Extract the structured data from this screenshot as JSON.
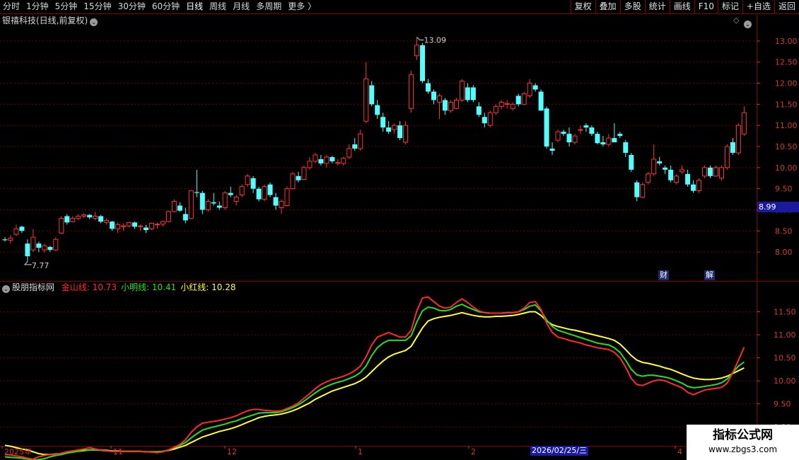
{
  "toolbar": {
    "period_tabs": [
      "分时",
      "1分钟",
      "5分钟",
      "15分钟",
      "30分钟",
      "60分钟",
      "日线",
      "周线",
      "月线",
      "多周期",
      "更多 〉"
    ],
    "active_period": "日线",
    "tools": [
      "复权",
      "叠加",
      "多股",
      "统计",
      "画线",
      "F10",
      "标记",
      "+自选",
      "返回"
    ]
  },
  "main_panel": {
    "title": "银禧科技(日线,前复权)",
    "high_annotation": "13.09",
    "low_annotation": "7.77",
    "current_price_tag": "8.99",
    "badges": [
      "财",
      "解"
    ],
    "y_ticks": [
      "13.00",
      "12.50",
      "12.00",
      "11.50",
      "11.00",
      "10.50",
      "10.00",
      "9.50",
      "9.00",
      "8.50",
      "8.00"
    ],
    "colors": {
      "up": "#ff3333",
      "down": "#54ffff"
    }
  },
  "indicator_panel": {
    "name": "股朋指标网",
    "lines": [
      {
        "label": "金山线:",
        "value": "10.73",
        "color": "#ff2a2a"
      },
      {
        "label": "小明线:",
        "value": "10.41",
        "color": "#22e022"
      },
      {
        "label": "小红线:",
        "value": "10.28",
        "color": "#ffff33"
      }
    ],
    "y_ticks": [
      "11.50",
      "11.00",
      "10.50",
      "10.00",
      "9.50",
      "9.00"
    ]
  },
  "x_axis": {
    "labels": [
      "2025年",
      "11",
      "12",
      "1",
      "2",
      "4"
    ],
    "cursor_date": "2026/02/25/三"
  },
  "watermark": {
    "line1": "指标公式网",
    "line2": "www.zbgs3.com"
  },
  "chart_data": {
    "type": "candlestick",
    "candles": [
      [
        8.3,
        8.35,
        8.25,
        8.28
      ],
      [
        8.28,
        8.4,
        8.2,
        8.33
      ],
      [
        8.42,
        8.65,
        8.38,
        8.55
      ],
      [
        8.6,
        8.62,
        8.45,
        8.5
      ],
      [
        8.2,
        8.3,
        7.77,
        7.9
      ],
      [
        8.05,
        8.55,
        8.0,
        8.35
      ],
      [
        8.2,
        8.25,
        8.0,
        8.1
      ],
      [
        8.05,
        8.2,
        7.98,
        8.15
      ],
      [
        8.12,
        8.15,
        8.0,
        8.05
      ],
      [
        8.05,
        8.35,
        8.02,
        8.3
      ],
      [
        8.45,
        8.85,
        8.42,
        8.8
      ],
      [
        8.85,
        8.9,
        8.65,
        8.7
      ],
      [
        8.72,
        8.85,
        8.7,
        8.8
      ],
      [
        8.8,
        8.9,
        8.75,
        8.85
      ],
      [
        8.85,
        8.92,
        8.8,
        8.88
      ],
      [
        8.88,
        8.9,
        8.78,
        8.82
      ],
      [
        8.8,
        8.95,
        8.75,
        8.85
      ],
      [
        8.85,
        8.88,
        8.68,
        8.72
      ],
      [
        8.7,
        8.8,
        8.65,
        8.75
      ],
      [
        8.72,
        8.74,
        8.5,
        8.55
      ],
      [
        8.55,
        8.7,
        8.45,
        8.65
      ],
      [
        8.6,
        8.68,
        8.5,
        8.62
      ],
      [
        8.62,
        8.72,
        8.58,
        8.7
      ],
      [
        8.7,
        8.72,
        8.55,
        8.6
      ],
      [
        8.6,
        8.65,
        8.5,
        8.62
      ],
      [
        8.58,
        8.64,
        8.45,
        8.52
      ],
      [
        8.55,
        8.7,
        8.52,
        8.68
      ],
      [
        8.65,
        8.7,
        8.55,
        8.66
      ],
      [
        8.66,
        8.75,
        8.6,
        8.72
      ],
      [
        8.72,
        8.98,
        8.7,
        8.96
      ],
      [
        8.96,
        9.25,
        8.94,
        9.2
      ],
      [
        9.1,
        9.18,
        8.95,
        8.98
      ],
      [
        8.9,
        9.05,
        8.68,
        8.75
      ],
      [
        8.8,
        9.45,
        8.78,
        9.45
      ],
      [
        9.42,
        9.95,
        9.3,
        9.4
      ],
      [
        9.4,
        9.45,
        8.9,
        9.0
      ],
      [
        9.0,
        9.25,
        8.95,
        9.2
      ],
      [
        9.18,
        9.4,
        9.1,
        9.15
      ],
      [
        9.1,
        9.2,
        9.0,
        9.05
      ],
      [
        9.05,
        9.45,
        9.0,
        9.4
      ],
      [
        9.4,
        9.55,
        9.3,
        9.35
      ],
      [
        9.2,
        9.35,
        9.1,
        9.3
      ],
      [
        9.35,
        9.6,
        9.3,
        9.55
      ],
      [
        9.6,
        9.85,
        9.55,
        9.8
      ],
      [
        9.75,
        9.8,
        9.4,
        9.5
      ],
      [
        9.5,
        9.55,
        9.2,
        9.25
      ],
      [
        9.25,
        9.6,
        9.2,
        9.55
      ],
      [
        9.6,
        9.65,
        9.3,
        9.35
      ],
      [
        9.3,
        9.4,
        9.0,
        9.1
      ],
      [
        9.05,
        9.25,
        8.9,
        9.2
      ],
      [
        9.1,
        9.55,
        9.08,
        9.5
      ],
      [
        9.5,
        9.9,
        9.48,
        9.85
      ],
      [
        9.8,
        9.9,
        9.65,
        9.7
      ],
      [
        9.72,
        10.05,
        9.7,
        10.0
      ],
      [
        10.0,
        10.25,
        9.95,
        10.15
      ],
      [
        10.15,
        10.35,
        10.1,
        10.3
      ],
      [
        10.2,
        10.3,
        10.05,
        10.1
      ],
      [
        10.1,
        10.3,
        10.0,
        10.25
      ],
      [
        10.25,
        10.28,
        10.1,
        10.15
      ],
      [
        10.1,
        10.2,
        10.05,
        10.12
      ],
      [
        10.1,
        10.25,
        10.05,
        10.22
      ],
      [
        10.25,
        10.55,
        10.2,
        10.45
      ],
      [
        10.55,
        10.7,
        10.4,
        10.45
      ],
      [
        10.45,
        10.9,
        10.4,
        10.8
      ],
      [
        11.1,
        12.5,
        11.05,
        12.1
      ],
      [
        11.95,
        12.05,
        11.45,
        11.5
      ],
      [
        11.48,
        11.6,
        11.15,
        11.25
      ],
      [
        11.2,
        11.3,
        10.85,
        10.95
      ],
      [
        10.95,
        11.1,
        10.8,
        10.85
      ],
      [
        10.9,
        11.05,
        10.8,
        11.0
      ],
      [
        11.0,
        11.1,
        10.65,
        10.7
      ],
      [
        10.6,
        11.1,
        10.55,
        11.0
      ],
      [
        11.4,
        12.3,
        11.3,
        12.2
      ],
      [
        12.65,
        13.09,
        12.55,
        12.9
      ],
      [
        12.9,
        12.95,
        12.0,
        12.05
      ],
      [
        12.0,
        12.1,
        11.75,
        11.8
      ],
      [
        11.8,
        11.85,
        11.5,
        11.6
      ],
      [
        11.55,
        11.75,
        11.15,
        11.7
      ],
      [
        11.6,
        11.65,
        11.25,
        11.35
      ],
      [
        11.35,
        11.6,
        11.3,
        11.55
      ],
      [
        11.4,
        11.65,
        11.38,
        11.6
      ],
      [
        11.6,
        12.1,
        11.55,
        12.05
      ],
      [
        11.9,
        12.0,
        11.55,
        11.6
      ],
      [
        11.9,
        11.95,
        11.55,
        11.6
      ],
      [
        11.45,
        11.55,
        11.2,
        11.25
      ],
      [
        11.2,
        11.3,
        10.95,
        11.05
      ],
      [
        11.0,
        11.35,
        10.95,
        11.3
      ],
      [
        11.3,
        11.5,
        11.25,
        11.45
      ],
      [
        11.45,
        11.6,
        11.38,
        11.55
      ],
      [
        11.5,
        11.6,
        11.4,
        11.52
      ],
      [
        11.4,
        11.55,
        11.35,
        11.5
      ],
      [
        11.7,
        11.75,
        11.45,
        11.5
      ],
      [
        11.5,
        11.8,
        11.48,
        11.75
      ],
      [
        11.7,
        12.1,
        11.65,
        12.0
      ],
      [
        11.95,
        12.0,
        11.8,
        11.85
      ],
      [
        11.8,
        11.85,
        11.45,
        11.35
      ],
      [
        11.4,
        11.45,
        10.45,
        10.5
      ],
      [
        10.45,
        10.6,
        10.3,
        10.4
      ],
      [
        10.65,
        10.9,
        10.6,
        10.85
      ],
      [
        10.85,
        10.9,
        10.75,
        10.8
      ],
      [
        10.8,
        10.95,
        10.5,
        10.6
      ],
      [
        10.6,
        10.8,
        10.55,
        10.75
      ],
      [
        10.9,
        11.0,
        10.8,
        10.9
      ],
      [
        11.0,
        11.05,
        10.85,
        10.95
      ],
      [
        10.95,
        11.0,
        10.75,
        10.8
      ],
      [
        10.8,
        10.85,
        10.55,
        10.58
      ],
      [
        10.6,
        10.75,
        10.5,
        10.55
      ],
      [
        10.55,
        10.8,
        10.5,
        10.7
      ],
      [
        10.7,
        11.05,
        10.65,
        10.6
      ],
      [
        10.8,
        10.85,
        10.7,
        10.75
      ],
      [
        10.6,
        10.65,
        10.25,
        10.35
      ],
      [
        10.3,
        10.35,
        9.9,
        9.95
      ],
      [
        9.65,
        9.7,
        9.2,
        9.3
      ],
      [
        9.3,
        9.65,
        9.28,
        9.6
      ],
      [
        9.65,
        9.9,
        9.6,
        9.85
      ],
      [
        9.85,
        10.55,
        9.8,
        10.2
      ],
      [
        10.15,
        10.25,
        10.05,
        10.1
      ],
      [
        10.0,
        10.05,
        9.85,
        9.95
      ],
      [
        9.95,
        10.05,
        9.65,
        9.7
      ],
      [
        9.65,
        9.85,
        9.6,
        9.8
      ],
      [
        9.9,
        10.05,
        9.85,
        9.95
      ],
      [
        9.85,
        9.95,
        9.55,
        9.6
      ],
      [
        9.6,
        9.7,
        9.4,
        9.45
      ],
      [
        9.45,
        9.75,
        9.4,
        9.7
      ],
      [
        9.8,
        10.05,
        9.75,
        10.0
      ],
      [
        10.0,
        10.05,
        9.75,
        9.8
      ],
      [
        9.8,
        10.05,
        9.78,
        10.0
      ],
      [
        9.75,
        10.05,
        9.7,
        10.0
      ],
      [
        10.0,
        10.55,
        9.95,
        10.5
      ],
      [
        10.6,
        10.7,
        10.3,
        10.35
      ],
      [
        10.35,
        11.05,
        10.3,
        11.0
      ],
      [
        10.8,
        11.45,
        10.75,
        11.3
      ]
    ],
    "series": [
      {
        "name": "金山线",
        "color": "#ff2a2a",
        "values": [
          8.4,
          8.39,
          8.37,
          8.35,
          8.32,
          8.3,
          8.35,
          8.38,
          8.4,
          8.4,
          8.43,
          8.46,
          8.48,
          8.5,
          8.52,
          8.55,
          8.52,
          8.5,
          8.48,
          8.47,
          8.47,
          8.47,
          8.47,
          8.47,
          8.47,
          8.46,
          8.45,
          8.44,
          8.46,
          8.5,
          8.56,
          8.62,
          8.72,
          8.88,
          9.0,
          9.08,
          9.1,
          9.12,
          9.14,
          9.17,
          9.2,
          9.24,
          9.3,
          9.35,
          9.38,
          9.38,
          9.36,
          9.35,
          9.34,
          9.35,
          9.4,
          9.45,
          9.52,
          9.62,
          9.72,
          9.83,
          9.92,
          9.98,
          10.03,
          10.06,
          10.1,
          10.15,
          10.22,
          10.32,
          10.52,
          10.78,
          10.95,
          11.0,
          11.05,
          11.0,
          10.95,
          10.95,
          11.1,
          11.52,
          11.8,
          11.82,
          11.72,
          11.62,
          11.58,
          11.6,
          11.7,
          11.78,
          11.7,
          11.6,
          11.52,
          11.48,
          11.47,
          11.47,
          11.47,
          11.48,
          11.48,
          11.5,
          11.58,
          11.7,
          11.72,
          11.55,
          11.25,
          11.05,
          10.95,
          10.92,
          10.88,
          10.85,
          10.82,
          10.78,
          10.75,
          10.72,
          10.7,
          10.68,
          10.62,
          10.5,
          10.3,
          10.05,
          9.92,
          9.9,
          9.95,
          10.0,
          10.02,
          10.0,
          9.95,
          9.9,
          9.85,
          9.75,
          9.7,
          9.75,
          9.8,
          9.82,
          9.84,
          9.86,
          9.95,
          10.18,
          10.45,
          10.73
        ]
      },
      {
        "name": "小明线",
        "color": "#22e022",
        "values": [
          8.35,
          8.34,
          8.33,
          8.32,
          8.3,
          8.28,
          8.29,
          8.31,
          8.35,
          8.38,
          8.4,
          8.43,
          8.45,
          8.47,
          8.48,
          8.5,
          8.5,
          8.49,
          8.48,
          8.47,
          8.47,
          8.47,
          8.47,
          8.47,
          8.47,
          8.46,
          8.46,
          8.46,
          8.47,
          8.5,
          8.55,
          8.6,
          8.66,
          8.76,
          8.85,
          8.93,
          8.97,
          9.0,
          9.03,
          9.06,
          9.1,
          9.13,
          9.18,
          9.22,
          9.26,
          9.3,
          9.31,
          9.31,
          9.31,
          9.33,
          9.37,
          9.42,
          9.48,
          9.56,
          9.65,
          9.74,
          9.82,
          9.88,
          9.93,
          9.97,
          10.0,
          10.05,
          10.1,
          10.18,
          10.32,
          10.55,
          10.72,
          10.82,
          10.88,
          10.88,
          10.88,
          10.88,
          10.98,
          11.28,
          11.52,
          11.6,
          11.58,
          11.53,
          11.52,
          11.55,
          11.62,
          11.66,
          11.6,
          11.55,
          11.5,
          11.48,
          11.47,
          11.47,
          11.47,
          11.48,
          11.48,
          11.5,
          11.55,
          11.62,
          11.65,
          11.52,
          11.32,
          11.18,
          11.1,
          11.06,
          11.02,
          10.98,
          10.94,
          10.9,
          10.86,
          10.82,
          10.8,
          10.78,
          10.72,
          10.62,
          10.45,
          10.25,
          10.13,
          10.1,
          10.12,
          10.12,
          10.1,
          10.08,
          10.05,
          10.0,
          9.95,
          9.88,
          9.85,
          9.86,
          9.88,
          9.9,
          9.92,
          9.96,
          10.04,
          10.18,
          10.32,
          10.41
        ]
      },
      {
        "name": "小红线",
        "color": "#ffff33",
        "values": [
          8.6,
          8.58,
          8.55,
          8.52,
          8.5,
          8.46,
          8.42,
          8.4,
          8.4,
          8.41,
          8.42,
          8.44,
          8.46,
          8.48,
          8.49,
          8.5,
          8.5,
          8.5,
          8.49,
          8.48,
          8.48,
          8.47,
          8.47,
          8.47,
          8.47,
          8.46,
          8.46,
          8.46,
          8.47,
          8.49,
          8.52,
          8.56,
          8.6,
          8.66,
          8.72,
          8.78,
          8.82,
          8.86,
          8.9,
          8.93,
          8.96,
          9.0,
          9.05,
          9.1,
          9.15,
          9.2,
          9.23,
          9.25,
          9.26,
          9.28,
          9.31,
          9.35,
          9.4,
          9.46,
          9.52,
          9.6,
          9.66,
          9.72,
          9.78,
          9.82,
          9.86,
          9.9,
          9.94,
          10.0,
          10.08,
          10.2,
          10.32,
          10.43,
          10.52,
          10.58,
          10.62,
          10.66,
          10.75,
          10.95,
          11.15,
          11.3,
          11.35,
          11.38,
          11.4,
          11.42,
          11.45,
          11.48,
          11.45,
          11.42,
          11.4,
          11.39,
          11.39,
          11.4,
          11.4,
          11.41,
          11.42,
          11.44,
          11.47,
          11.5,
          11.5,
          11.42,
          11.3,
          11.22,
          11.18,
          11.15,
          11.12,
          11.1,
          11.07,
          11.04,
          11.01,
          10.98,
          10.95,
          10.92,
          10.88,
          10.8,
          10.68,
          10.55,
          10.45,
          10.4,
          10.38,
          10.35,
          10.32,
          10.28,
          10.25,
          10.2,
          10.15,
          10.1,
          10.06,
          10.04,
          10.03,
          10.03,
          10.04,
          10.06,
          10.1,
          10.16,
          10.22,
          10.28
        ]
      }
    ],
    "price_axis": {
      "min": 7.6,
      "max": 13.3
    },
    "indicator_axis": {
      "min": 8.65,
      "max": 12.0
    }
  }
}
